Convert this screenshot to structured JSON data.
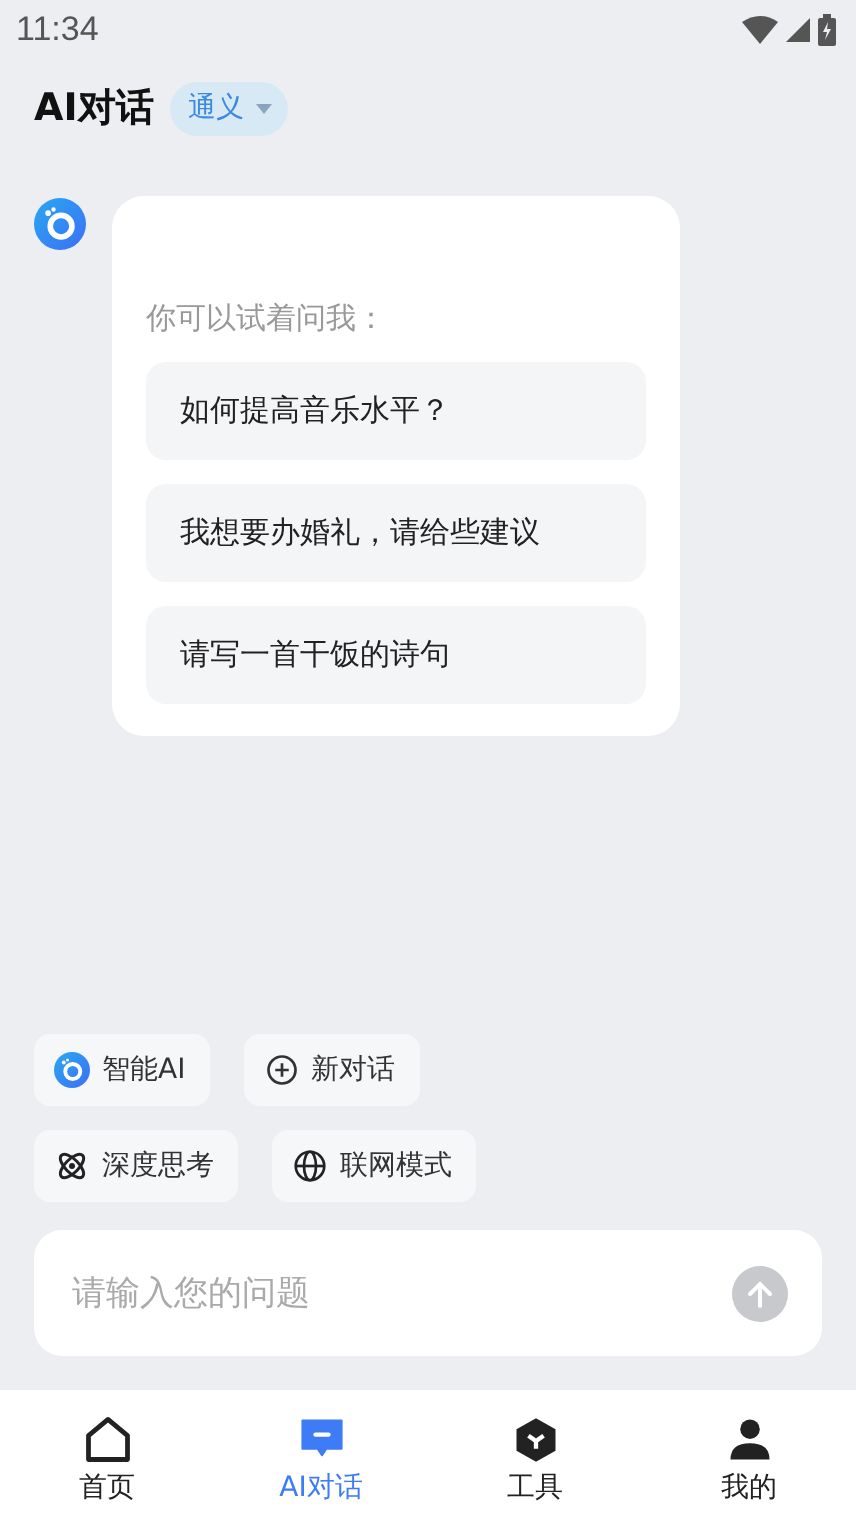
{
  "status_bar": {
    "time": "11:34"
  },
  "header": {
    "title": "AI对话",
    "model": "通义"
  },
  "chat": {
    "prompt": "你可以试着问我：",
    "suggestions": [
      "如何提高音乐水平？",
      "我想要办婚礼，请给些建议",
      "请写一首干饭的诗句"
    ]
  },
  "chips": [
    [
      {
        "kind": "logo",
        "label": "智能AI"
      },
      {
        "kind": "plus",
        "label": "新对话"
      }
    ],
    [
      {
        "kind": "atom",
        "label": "深度思考"
      },
      {
        "kind": "globe",
        "label": "联网模式"
      }
    ]
  ],
  "input": {
    "placeholder": "请输入您的问题"
  },
  "tabs": [
    {
      "kind": "home",
      "label": "首页",
      "selected": false
    },
    {
      "kind": "chat",
      "label": "AI对话",
      "selected": true
    },
    {
      "kind": "tools",
      "label": "工具",
      "selected": false
    },
    {
      "kind": "profile",
      "label": "我的",
      "selected": false
    }
  ]
}
